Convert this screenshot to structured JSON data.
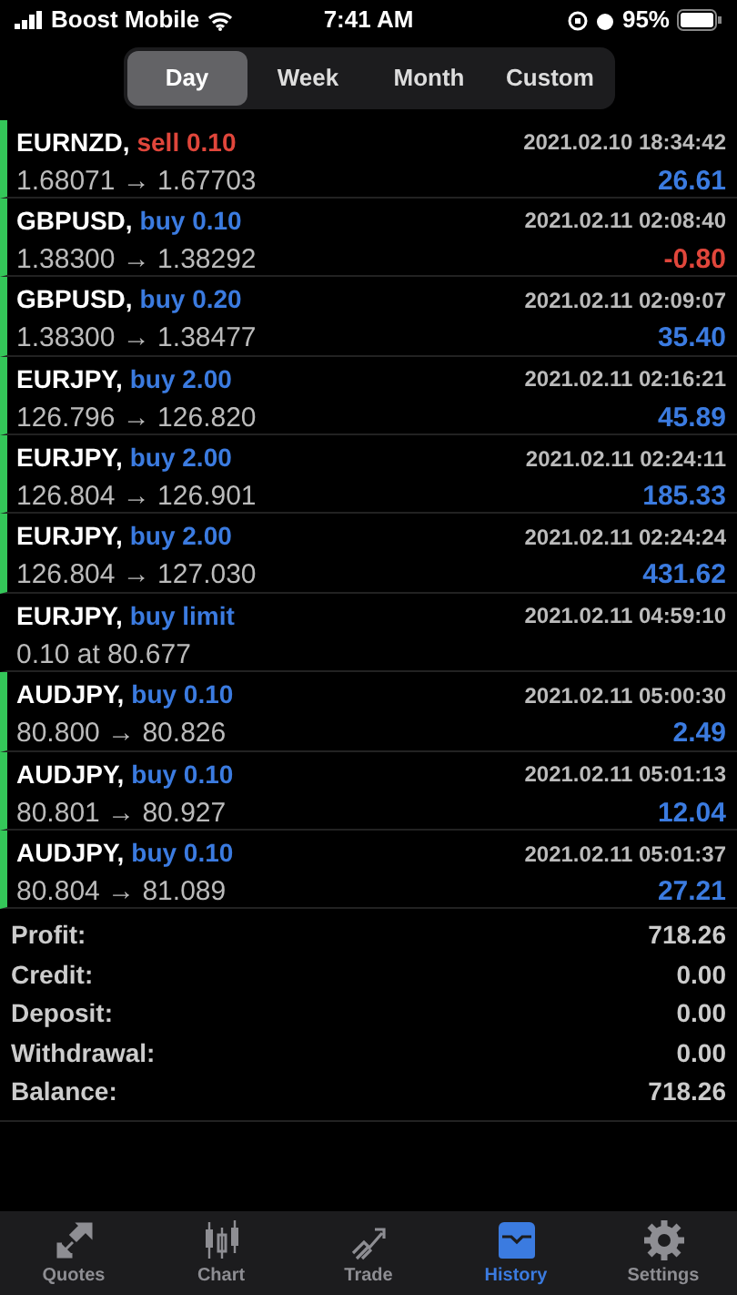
{
  "status_bar": {
    "carrier": "Boost Mobile",
    "time": "7:41 AM",
    "battery": "95%"
  },
  "periods": [
    {
      "label": "Day",
      "selected": true
    },
    {
      "label": "Week",
      "selected": false
    },
    {
      "label": "Month",
      "selected": false
    },
    {
      "label": "Custom",
      "selected": false
    }
  ],
  "rows": [
    {
      "kind": "deal",
      "symbol": "EURNZD,",
      "sell": true,
      "action": "sell 0.10",
      "time": "2021.02.10 18:34:42",
      "prices": "1.68071 → 1.67703",
      "profit": "26.61",
      "loss": false
    },
    {
      "kind": "deal",
      "symbol": "GBPUSD,",
      "sell": false,
      "action": "buy 0.10",
      "time": "2021.02.11 02:08:40",
      "prices": "1.38300 → 1.38292",
      "profit": "-0.80",
      "loss": true
    },
    {
      "kind": "deal",
      "symbol": "GBPUSD,",
      "sell": false,
      "action": "buy 0.20",
      "time": "2021.02.11 02:09:07",
      "prices": "1.38300 → 1.38477",
      "profit": "35.40",
      "loss": false
    },
    {
      "kind": "deal",
      "symbol": "EURJPY,",
      "sell": false,
      "action": "buy 2.00",
      "time": "2021.02.11 02:16:21",
      "prices": "126.796 → 126.820",
      "profit": "45.89",
      "loss": false
    },
    {
      "kind": "deal",
      "symbol": "EURJPY,",
      "sell": false,
      "action": "buy 2.00",
      "time": "2021.02.11 02:24:11",
      "prices": "126.804 → 126.901",
      "profit": "185.33",
      "loss": false
    },
    {
      "kind": "deal",
      "symbol": "EURJPY,",
      "sell": false,
      "action": "buy 2.00",
      "time": "2021.02.11 02:24:24",
      "prices": "126.804 → 127.030",
      "profit": "431.62",
      "loss": false
    },
    {
      "kind": "order",
      "symbol": "EURJPY,",
      "sell": false,
      "action": "buy limit",
      "time": "2021.02.11 04:59:10",
      "prices": "0.10 at 80.677"
    },
    {
      "kind": "deal",
      "symbol": "AUDJPY,",
      "sell": false,
      "action": "buy 0.10",
      "time": "2021.02.11 05:00:30",
      "prices": "80.800 → 80.826",
      "profit": "2.49",
      "loss": false
    },
    {
      "kind": "deal",
      "symbol": "AUDJPY,",
      "sell": false,
      "action": "buy 0.10",
      "time": "2021.02.11 05:01:13",
      "prices": "80.801 → 80.927",
      "profit": "12.04",
      "loss": false
    },
    {
      "kind": "deal",
      "symbol": "AUDJPY,",
      "sell": false,
      "action": "buy 0.10",
      "time": "2021.02.11 05:01:37",
      "prices": "80.804 → 81.089",
      "profit": "27.21",
      "loss": false
    }
  ],
  "summary": [
    {
      "label": "Profit:",
      "value": "718.26"
    },
    {
      "label": "Credit:",
      "value": "0.00"
    },
    {
      "label": "Deposit:",
      "value": "0.00"
    },
    {
      "label": "Withdrawal:",
      "value": "0.00"
    },
    {
      "label": "Balance:",
      "value": "718.26"
    }
  ],
  "tabs": [
    {
      "kind": "quotes",
      "label": "Quotes",
      "selected": false
    },
    {
      "kind": "chart",
      "label": "Chart",
      "selected": false
    },
    {
      "kind": "trade",
      "label": "Trade",
      "selected": false
    },
    {
      "kind": "history",
      "label": "History",
      "selected": true
    },
    {
      "kind": "settings",
      "label": "Settings",
      "selected": false
    }
  ]
}
